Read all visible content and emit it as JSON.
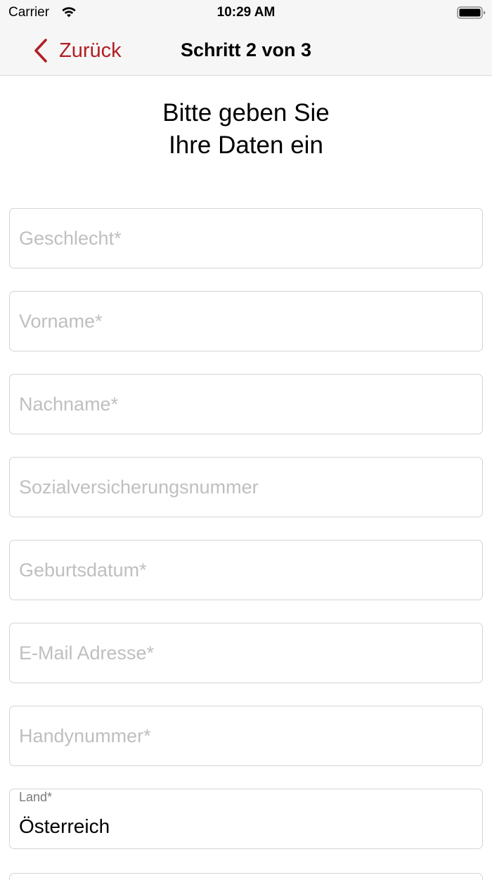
{
  "status_bar": {
    "carrier": "Carrier",
    "time": "10:29 AM"
  },
  "nav": {
    "back_label": "Zurück",
    "title": "Schritt 2 von 3",
    "accent_color": "#b21f24"
  },
  "page": {
    "title_line1": "Bitte geben Sie",
    "title_line2": "Ihre Daten ein"
  },
  "form": {
    "gender": {
      "placeholder": "Geschlecht*"
    },
    "first_name": {
      "placeholder": "Vorname*"
    },
    "last_name": {
      "placeholder": "Nachname*"
    },
    "social_security": {
      "placeholder": "Sozialversicherungsnummer"
    },
    "birth_date": {
      "placeholder": "Geburtsdatum*"
    },
    "email": {
      "placeholder": "E-Mail Adresse*"
    },
    "mobile": {
      "placeholder": "Handynummer*"
    },
    "country": {
      "label": "Land*",
      "value": "Österreich"
    }
  }
}
